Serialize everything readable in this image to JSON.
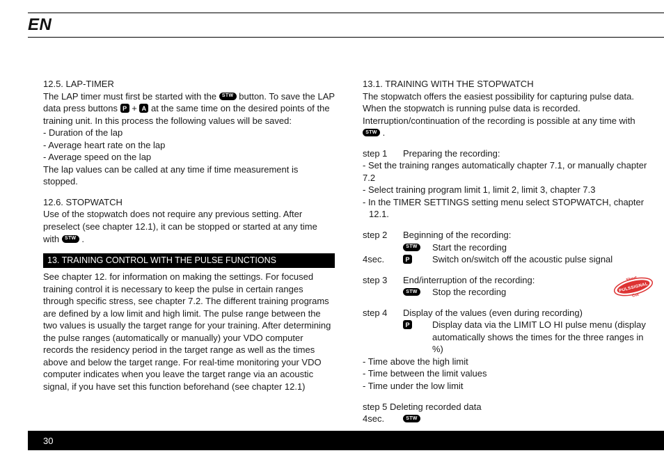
{
  "header": {
    "lang": "EN"
  },
  "footer": {
    "page": "30"
  },
  "icons": {
    "stw": "STW",
    "p": "P",
    "a": "A"
  },
  "badge": {
    "top": "Short",
    "mid": "PULSSIGNAL",
    "bot": "Cut"
  },
  "col1": {
    "s125_title": "12.5. LAP-TIMER",
    "s125_p1a": "The LAP timer must first be started with the ",
    "s125_p1b": " button. To save the LAP data press buttons ",
    "s125_p1c": " + ",
    "s125_p1d": " at the same time on the desired points of the training unit. In this process the following values will be saved:",
    "s125_b1": "- Duration of the lap",
    "s125_b2": "- Average heart rate on the lap",
    "s125_b3": "- Average speed on the lap",
    "s125_p2": "The lap values can be called at any time if time measurement is stopped.",
    "s126_title": "12.6. STOPWATCH",
    "s126_p1a": "Use of the stopwatch does not require any previous setting. After preselect (see chapter 12.1), it can be stopped or started at any time with ",
    "s126_p1b": " .",
    "s13_head": "13. TRAINING CONTROL WITH THE PULSE FUNCTIONS",
    "s13_p1": "See chapter 12. for information on making the settings. For focused training control it is necessary to keep the pulse in certain ranges through specific stress, see chapter 7.2. The different training programs are defined by a low limit and high limit. The pulse range between the two values is usually the target range for your training. After determining the pulse ranges (automatically or manually) your VDO computer records the residency period in the target range as well as the times above and below the target range. For real-time monitoring your VDO computer indicates when you leave the target range via an acoustic signal, if you have set this function beforehand (see chapter 12.1)"
  },
  "col2": {
    "s131_title": "13.1. TRAINING WITH THE STOPWATCH",
    "s131_p1a": "The stopwatch offers the easiest possibility for capturing pulse data. When the stopwatch is running pulse data is recorded. Interruption/continuation of the recording is possible at any time with ",
    "s131_p1b": " .",
    "step1_label": "step 1",
    "step1_title": "Preparing the recording:",
    "step1_b1": "- Set the training ranges automatically chapter 7.1, or manually chapter 7.2",
    "step1_b2": "- Select training program limit 1, limit 2, limit 3, chapter 7.3",
    "step1_b3": "- In the TIMER SETTINGS setting menu select STOPWATCH, chapter 12.1.",
    "step2_label": "step 2",
    "step2_title": "Beginning of the recording:",
    "step2_r1": "Start the recording",
    "step2_4sec": "4sec.",
    "step2_r2": "Switch on/switch off the acoustic pulse signal",
    "step3_label": "step 3",
    "step3_title": "End/interruption of the recording:",
    "step3_r1": "Stop the recording",
    "step4_label": "step 4",
    "step4_title": "Display of the values (even during recording)",
    "step4_r1": "Display data via the LIMIT LO HI pulse menu (display automatically shows the times for the three ranges in %)",
    "step4_b1": "- Time above the high limit",
    "step4_b2": "- Time between the limit values",
    "step4_b3": "- Time under the low limit",
    "step5_label": "step 5 Deleting recorded data",
    "step5_4sec": "4sec."
  }
}
